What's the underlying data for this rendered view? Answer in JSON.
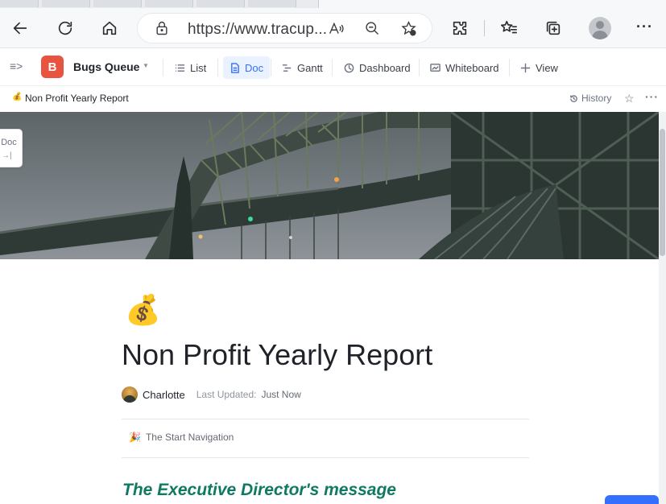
{
  "browser": {
    "url": "https://www.tracup...",
    "read_aloud_icon": "A))"
  },
  "app_bar": {
    "space_badge": "B",
    "space_name": "Bugs Queue",
    "views": [
      {
        "label": "List",
        "icon": "list-icon"
      },
      {
        "label": "Doc",
        "icon": "doc-icon",
        "active": true
      },
      {
        "label": "Gantt",
        "icon": "gantt-icon"
      },
      {
        "label": "Dashboard",
        "icon": "dashboard-icon"
      },
      {
        "label": "Whiteboard",
        "icon": "whiteboard-icon"
      },
      {
        "label": "View",
        "icon": "plus-icon"
      }
    ]
  },
  "breadcrumb": {
    "emoji": "💰",
    "title": "Non Profit Yearly Report",
    "history_label": "History"
  },
  "side_tab": {
    "label": "Doc",
    "arrow": "→|"
  },
  "document": {
    "emoji": "💰",
    "title": "Non Profit Yearly Report",
    "author": "Charlotte",
    "updated_label": "Last Updated:",
    "updated_value": "Just Now",
    "toc_emoji": "🎉",
    "toc_label": "The Start Navigation",
    "section_heading": "The Executive Director's message"
  },
  "colors": {
    "accent": "#3370ff",
    "space_badge": "#e8543f",
    "heading_green": "#0f7a62"
  }
}
